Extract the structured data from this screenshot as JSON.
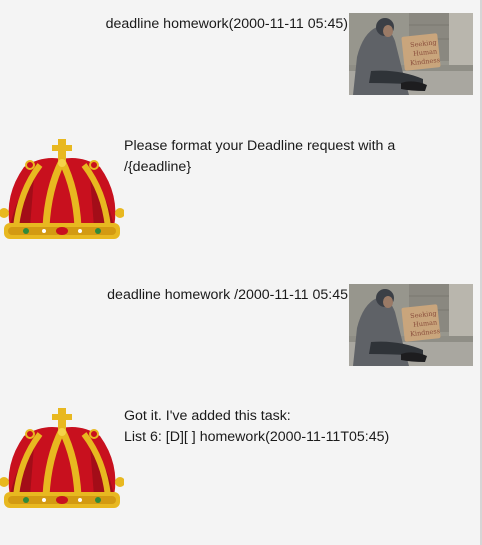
{
  "messages": [
    {
      "sender": "user",
      "text": "deadline homework(2000-11-11 05:45)",
      "avatar_icon": "homeless-man-photo"
    },
    {
      "sender": "bot",
      "lines": [
        "Please format your Deadline request with a",
        "/{deadline}"
      ],
      "avatar_icon": "crown-icon"
    },
    {
      "sender": "user",
      "text": "deadline homework /2000-11-11 05:45",
      "avatar_icon": "homeless-man-photo"
    },
    {
      "sender": "bot",
      "lines": [
        "Got it. I've added this task:",
        "List 6: [D][ ] homework(2000-11-11T05:45)"
      ],
      "avatar_icon": "crown-icon"
    }
  ],
  "photo_sign_text": [
    "Seeking",
    "Human",
    "Kindness"
  ],
  "colors": {
    "background": "#f4f4f4",
    "crown_red": "#c8101e",
    "crown_gold": "#e8b820"
  }
}
